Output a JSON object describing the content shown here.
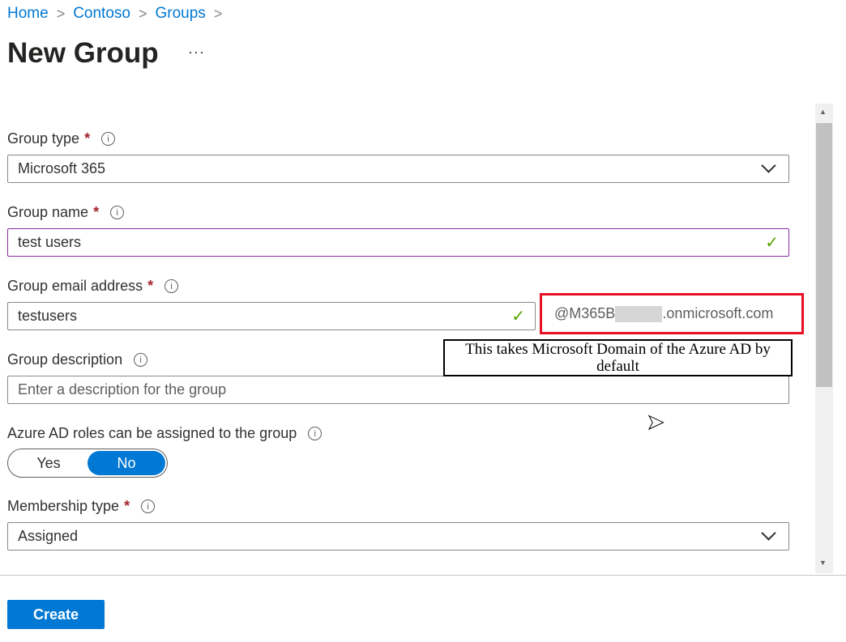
{
  "breadcrumb": [
    "Home",
    "Contoso",
    "Groups"
  ],
  "page_title": "New Group",
  "more_label": "···",
  "fields": {
    "group_type": {
      "label": "Group type",
      "value": "Microsoft 365"
    },
    "group_name": {
      "label": "Group name",
      "value": "test users"
    },
    "group_email": {
      "label": "Group email address",
      "value": "testusers",
      "domain_prefix": "@M365B",
      "domain_suffix": ".onmicrosoft.com"
    },
    "group_description": {
      "label": "Group description",
      "placeholder": "Enter a description for the group"
    },
    "azure_roles": {
      "label": "Azure AD roles can be assigned to the group",
      "options": [
        "Yes",
        "No"
      ],
      "selected": "No"
    },
    "membership_type": {
      "label": "Membership type",
      "value": "Assigned"
    }
  },
  "annotation": "This takes Microsoft Domain of the Azure AD by default",
  "create_label": "Create",
  "colors": {
    "accent": "#0078d4",
    "highlight": "#e81123",
    "required": "#a4262c"
  }
}
